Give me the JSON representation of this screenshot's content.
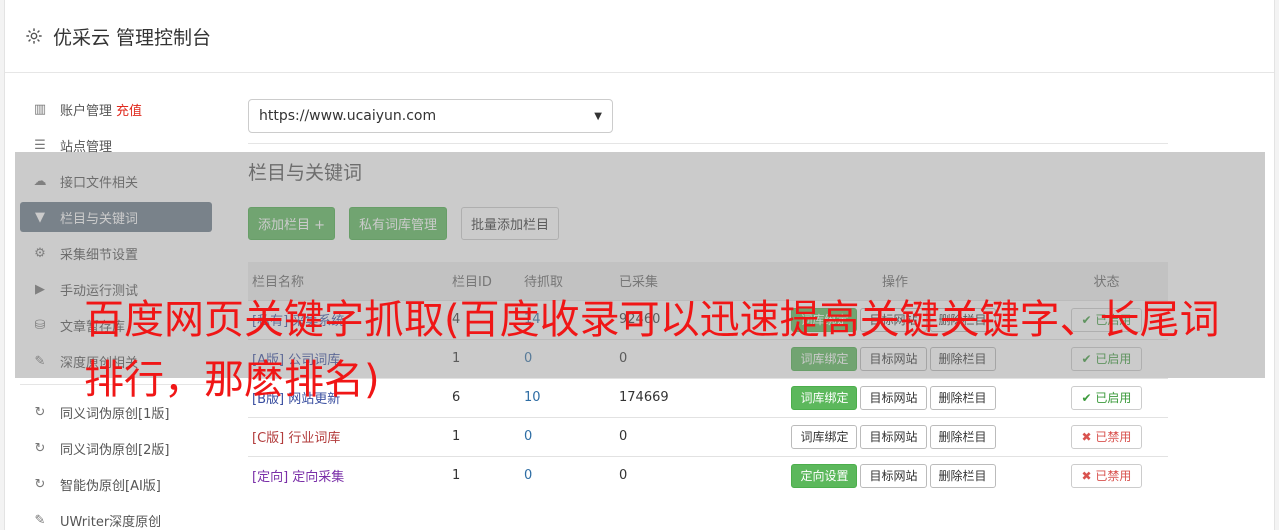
{
  "header": {
    "title": "优采云 管理控制台",
    "icon": "gear-icon"
  },
  "sidebar": {
    "items": [
      {
        "label": "账户管理",
        "accent": "充值",
        "icon": "bar-chart-icon"
      },
      {
        "label": "站点管理",
        "icon": "server-icon"
      },
      {
        "label": "接口文件相关",
        "icon": "cloud-upload-icon"
      },
      {
        "label": "栏目与关键词",
        "icon": "filter-icon",
        "active": true
      },
      {
        "label": "采集细节设置",
        "icon": "cogs-icon"
      },
      {
        "label": "手动运行测试",
        "icon": "play-circle-icon"
      },
      {
        "label": "文章暂存库",
        "icon": "database-icon"
      },
      {
        "label": "深度原创相关",
        "icon": "edit-icon"
      }
    ],
    "tools": [
      {
        "label": "同义词伪原创[1版]",
        "icon": "refresh-icon"
      },
      {
        "label": "同义词伪原创[2版]",
        "icon": "refresh-icon"
      },
      {
        "label": "智能伪原创[AI版]",
        "icon": "refresh-icon"
      },
      {
        "label": "UWriter深度原创",
        "icon": "edit-icon"
      }
    ]
  },
  "main": {
    "site_select": "https://www.ucaiyun.com",
    "section_title": "栏目与关键词",
    "buttons": {
      "add": "添加栏目 +",
      "private_lib": "私有词库管理",
      "batch_add": "批量添加栏目"
    },
    "table": {
      "headers": [
        "栏目名称",
        "栏目ID",
        "待抓取",
        "已采集",
        "操作",
        "状态"
      ],
      "rows": [
        {
          "tag": "[私有]",
          "name": "采集系统",
          "id": "4",
          "pending": "14",
          "collected": "92460",
          "op1": "词库绑定",
          "op1_green": true,
          "op2": "目标网站",
          "op3": "删除栏目",
          "status": "已启用",
          "on": true,
          "tagclass": ""
        },
        {
          "tag": "[A版]",
          "name": "公司词库",
          "id": "1",
          "pending": "0",
          "collected": "0",
          "op1": "词库绑定",
          "op1_green": true,
          "op2": "目标网站",
          "op3": "删除栏目",
          "status": "已启用",
          "on": true,
          "tagclass": ""
        },
        {
          "tag": "[B版]",
          "name": "网站更新",
          "id": "6",
          "pending": "10",
          "collected": "174669",
          "op1": "词库绑定",
          "op1_green": true,
          "op2": "目标网站",
          "op3": "删除栏目",
          "status": "已启用",
          "on": true,
          "tagclass": ""
        },
        {
          "tag": "[C版]",
          "name": "行业词库",
          "id": "1",
          "pending": "0",
          "collected": "0",
          "op1": "词库绑定",
          "op1_green": false,
          "op2": "目标网站",
          "op3": "删除栏目",
          "status": "已禁用",
          "on": false,
          "tagclass": "red"
        },
        {
          "tag": "[定向]",
          "name": "定向采集",
          "id": "1",
          "pending": "0",
          "collected": "0",
          "op1": "定向设置",
          "op1_green": true,
          "op2": "目标网站",
          "op3": "删除栏目",
          "status": "已禁用",
          "on": false,
          "tagclass": "purple"
        }
      ]
    }
  },
  "overlay_text": "百度网页关键字抓取(百度收录可以迅速提高关键关键字、长尾词排行，那麽排名)",
  "colors": {
    "accent_green": "#5cb85c",
    "active_nav": "#6b7a89",
    "overlay_red": "#f01616"
  }
}
